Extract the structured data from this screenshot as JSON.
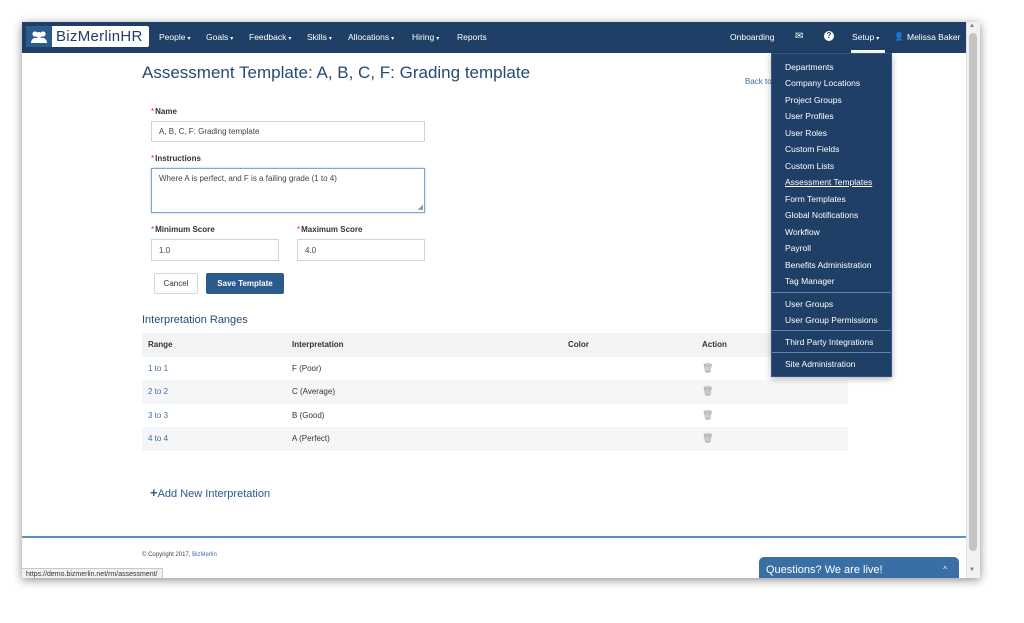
{
  "navbar": {
    "logo_text": "BizMerlinHR",
    "items": [
      {
        "label": "People",
        "caret": "▾"
      },
      {
        "label": "Goals",
        "caret": "▾"
      },
      {
        "label": "Feedback",
        "caret": "▾"
      },
      {
        "label": "Skills",
        "caret": "▾"
      },
      {
        "label": "Allocations",
        "caret": "▾"
      },
      {
        "label": "Hiring",
        "caret": "▾"
      },
      {
        "label": "Reports"
      }
    ],
    "onboarding": "Onboarding",
    "mail_icon": "✉",
    "help_icon": "?",
    "setup": {
      "label": "Setup",
      "caret": "▾"
    },
    "user_icon": "👤",
    "user_name": "Melissa Baker"
  },
  "setup_menu": {
    "items": [
      "Departments",
      "Company Locations",
      "Project Groups",
      "User Profiles",
      "User Roles",
      "Custom Fields",
      "Custom Lists",
      "Assessment Templates",
      "Form Templates",
      "Global Notifications",
      "Workflow",
      "Payroll",
      "Benefits Administration",
      "Tag Manager"
    ],
    "group_items": [
      "User Groups",
      "User Group Permissions"
    ],
    "integrations": "Third Party Integrations",
    "site_admin": "Site Administration",
    "active_item": "Assessment Templates"
  },
  "page": {
    "title": "Assessment Template: A, B, C, F: Grading template",
    "back_link": "Back to"
  },
  "form": {
    "required_mark": "*",
    "name_label": "Name",
    "name_value": "A, B, C, F: Grading template",
    "instructions_label": "Instructions",
    "instructions_value": "Where A is perfect, and F is a failing grade (1 to 4)",
    "min_label": "Minimum Score",
    "min_value": "1.0",
    "max_label": "Maximum Score",
    "max_value": "4.0",
    "cancel": "Cancel",
    "save": "Save Template"
  },
  "ranges": {
    "title": "Interpretation Ranges",
    "headers": [
      "Range",
      "Interpretation",
      "Color",
      "Action"
    ],
    "rows": [
      {
        "range": "1 to 1",
        "interpretation": "F (Poor)",
        "color": ""
      },
      {
        "range": "2 to 2",
        "interpretation": "C (Average)",
        "color": ""
      },
      {
        "range": "3 to 3",
        "interpretation": "B (Good)",
        "color": ""
      },
      {
        "range": "4 to 4",
        "interpretation": "A (Perfect)",
        "color": ""
      }
    ],
    "trash_icon": "🗑",
    "add_new": "Add New Interpretation",
    "add_icon": "+"
  },
  "footer": {
    "copyright": "© Copyright 2017,",
    "company": "BizMerlin"
  },
  "status_url": "https://demo.bizmerlin.net/rm/assessment/",
  "chat": {
    "label": "Questions? We are live!",
    "chevron": "^"
  },
  "colors": {
    "navbar": "#1f3f66",
    "primary": "#2b5a8c",
    "link": "#3a6fa6",
    "required": "#d9232d"
  }
}
